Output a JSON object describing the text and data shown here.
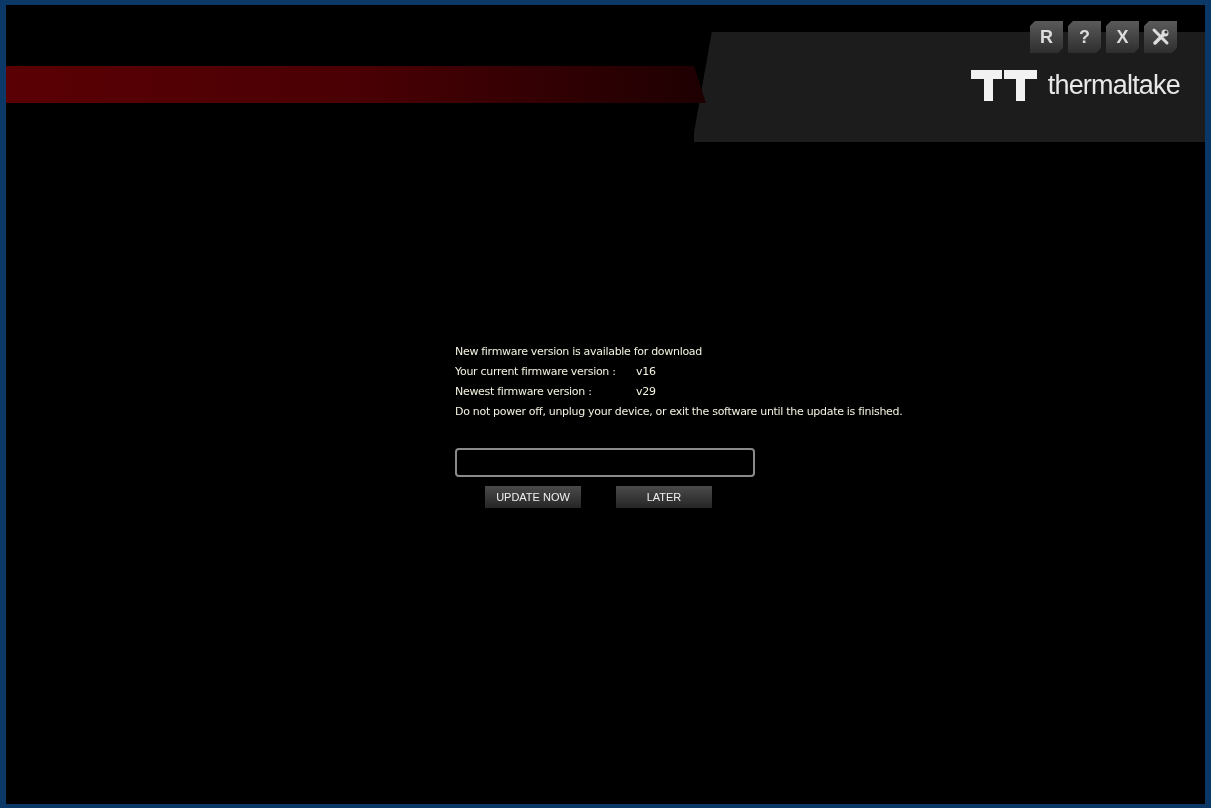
{
  "window_buttons": [
    {
      "kind": "text",
      "label": "R"
    },
    {
      "kind": "text",
      "label": "?"
    },
    {
      "kind": "text",
      "label": "X"
    },
    {
      "kind": "tools"
    }
  ],
  "logo": {
    "wordmark": "thermaltake"
  },
  "update": {
    "heading": "New firmware version is available for download",
    "versions": [
      {
        "label": "Your current firmware version :",
        "value": "v16"
      },
      {
        "label": "Newest firmware version :",
        "value": "v29"
      }
    ],
    "warning": "Do not power off, unplug your device, or exit the software until the update is finished.",
    "progress": {
      "level": 0
    },
    "buttons": [
      "UPDATE NOW",
      "LATER"
    ]
  }
}
